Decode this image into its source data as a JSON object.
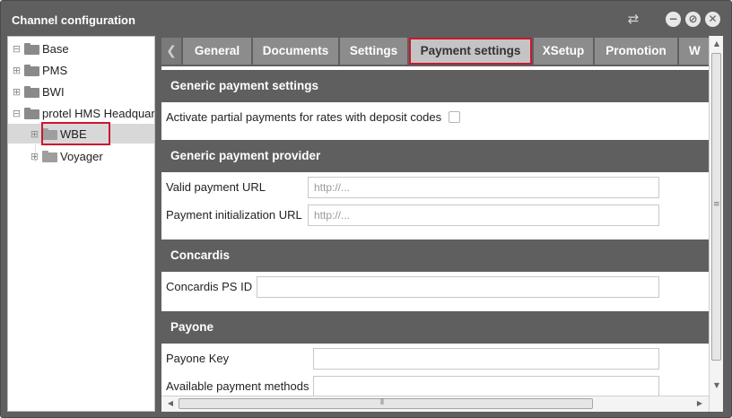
{
  "window": {
    "title": "Channel configuration"
  },
  "icons": {
    "swap": "⇄",
    "minimize": "−",
    "maximize": "⊘",
    "close": "✕",
    "expand": "⊞",
    "collapse": "⊟",
    "tab_left": "❮",
    "grip_v": "≡",
    "grip_h": "⦀"
  },
  "tree": {
    "items": [
      {
        "label": "Base",
        "state": "collapse"
      },
      {
        "label": "PMS",
        "state": "expand"
      },
      {
        "label": "BWI",
        "state": "expand"
      },
      {
        "label": "protel HMS Headquar",
        "state": "collapse"
      },
      {
        "label": "WBE",
        "state": "expand",
        "selected": true
      },
      {
        "label": "Voyager",
        "state": "expand"
      }
    ]
  },
  "tabs": [
    {
      "label": "General"
    },
    {
      "label": "Documents"
    },
    {
      "label": "Settings"
    },
    {
      "label": "Payment settings",
      "active": true
    },
    {
      "label": "XSetup"
    },
    {
      "label": "Promotion"
    },
    {
      "label": "W"
    }
  ],
  "sections": {
    "generic_settings": {
      "title": "Generic payment settings",
      "partial_payments_label": "Activate partial payments for rates with deposit codes",
      "partial_payments_checked": false
    },
    "generic_provider": {
      "title": "Generic payment provider",
      "valid_url_label": "Valid payment URL",
      "valid_url_placeholder": "http://...",
      "init_url_label": "Payment initialization URL",
      "init_url_placeholder": "http://..."
    },
    "concardis": {
      "title": "Concardis",
      "ps_id_label": "Concardis PS ID",
      "ps_id_value": ""
    },
    "payone": {
      "title": "Payone",
      "key_label": "Payone Key",
      "key_value": "",
      "methods_label": "Available payment methods",
      "methods_value": ""
    }
  },
  "colors": {
    "chrome": "#5f5f5f",
    "tab": "#8c8c8c",
    "tab_active": "#c4c4c4",
    "highlight": "#c8192e"
  }
}
